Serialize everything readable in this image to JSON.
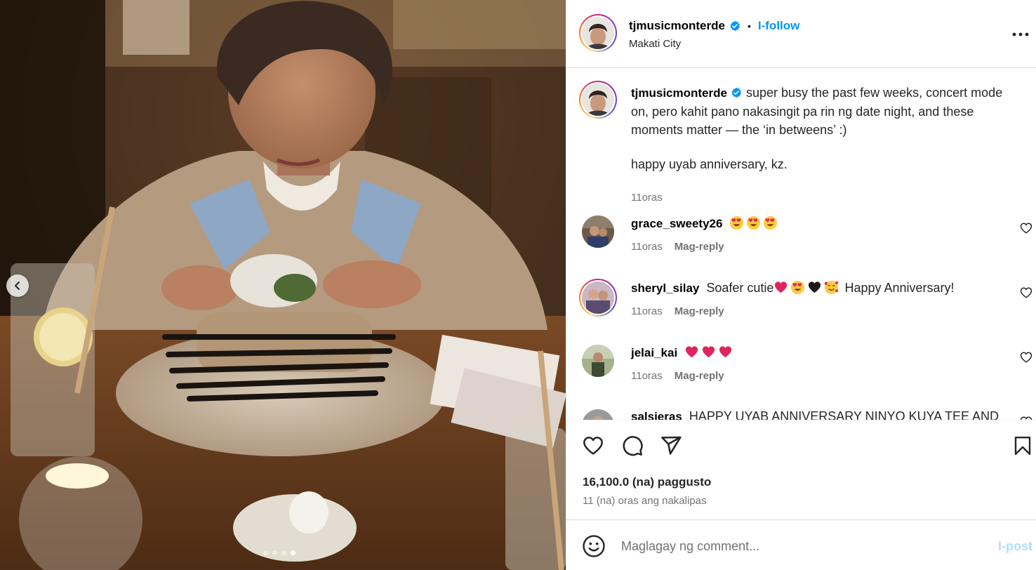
{
  "post": {
    "username": "tjmusicmonterde",
    "verified": true,
    "follow_label": "I-follow",
    "separator": "•",
    "location": "Makati City",
    "more_icon": "more-horizontal-icon"
  },
  "media": {
    "alt": "Photo of a person at a restaurant table holding a small floral arrangement",
    "total_slides": 4,
    "active_slide": 4,
    "prev_icon": "chevron-left-icon"
  },
  "caption": {
    "username": "tjmusicmonterde",
    "text_1": "super busy the past few weeks, concert mode on, pero kahit pano nakasingit pa rin ng date night, and these moments matter — the ‘in betweens’ :)",
    "text_2": "happy uyab anniversary, kz.",
    "time": "11oras"
  },
  "comments": [
    {
      "username": "grace_sweety26",
      "text": "",
      "emojis": [
        "heart-eyes",
        "heart-eyes",
        "heart-eyes"
      ],
      "time": "11oras",
      "reply_label": "Mag-reply"
    },
    {
      "username": "sheryl_silay",
      "text_before": "Soafer cutie",
      "emojis": [
        "red-heart",
        "heart-eyes",
        "black-heart",
        "smiling-hearts"
      ],
      "text_after": "Happy Anniversary!",
      "time": "11oras",
      "reply_label": "Mag-reply"
    },
    {
      "username": "jelai_kai",
      "text": "",
      "emojis": [
        "red-heart",
        "red-heart",
        "red-heart"
      ],
      "time": "11oras",
      "reply_label": "Mag-reply"
    },
    {
      "username": "salsieras",
      "text": "HAPPY UYAB ANNIVERSARY NINYO KUYA TEE AND"
    }
  ],
  "actions": {
    "like_icon": "heart-icon",
    "comment_icon": "comment-icon",
    "share_icon": "share-icon",
    "save_icon": "bookmark-icon"
  },
  "stats": {
    "likes": "16,100.0 (na) paggusto",
    "posted": "11 (na) oras ang nakalipas"
  },
  "composer": {
    "placeholder": "Maglagay ng comment...",
    "post_label": "I-post",
    "emoji_icon": "emoji-smile-icon"
  },
  "colors": {
    "accent": "#0095f6",
    "post_disabled": "#b2dffc",
    "secondary_text": "#737373",
    "verified": "#0095f6"
  }
}
